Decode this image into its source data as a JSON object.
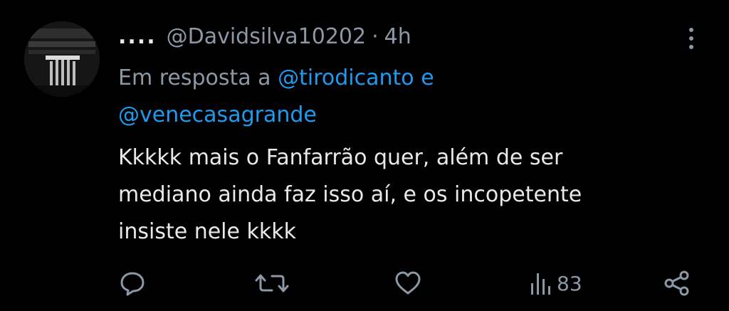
{
  "tweet": {
    "display_name": "....",
    "handle": "@Davidsilva10202",
    "separator": "·",
    "time": "4h",
    "reply_prefix": "Em resposta a",
    "reply_mention_1": "@tirodicanto",
    "reply_conjunction": "e",
    "reply_mention_2": "@venecasagrande",
    "body_lines": [
      "Kkkkk mais o Fanfarrão quer, além de ser",
      "mediano ainda faz isso aí, e os incopetente",
      "insiste nele kkkk"
    ],
    "views": "83"
  },
  "colors": {
    "background": "#000000",
    "text": "#e7e9ea",
    "muted": "#8b98a5",
    "link": "#1d9bf0"
  },
  "icons": {
    "reply": "speech-bubble-icon",
    "retweet": "retweet-arrows-icon",
    "like": "heart-icon",
    "views": "bar-chart-icon",
    "share": "share-nodes-icon",
    "more": "vertical-ellipsis-icon"
  }
}
